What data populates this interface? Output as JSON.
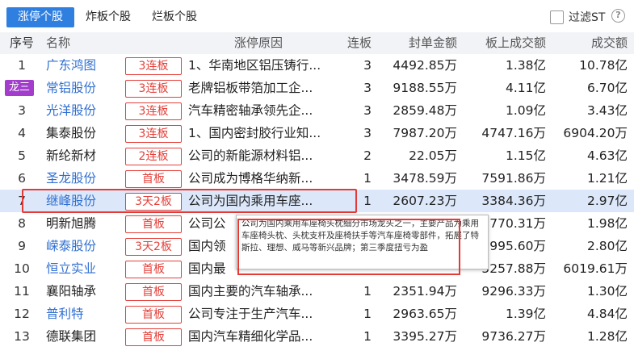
{
  "tabs": [
    {
      "label": "涨停个股",
      "active": true
    },
    {
      "label": "炸板个股",
      "active": false
    },
    {
      "label": "烂板个股",
      "active": false
    }
  ],
  "filter": {
    "label": "过滤ST",
    "checked": false
  },
  "help": {
    "symbol": "?"
  },
  "columns": {
    "idx": "序号",
    "name": "名称",
    "reason": "涨停原因",
    "lianban": "连板",
    "amount": "封单金额",
    "volume": "板上成交额",
    "turnover": "成交额"
  },
  "rows": [
    {
      "idx": "1",
      "name": "广东鸿图",
      "blue": true,
      "badge": "3连板",
      "reason": "1、华南地区铝压铸行...",
      "lb": "3",
      "amt": "4492.85万",
      "vol": "1.38亿",
      "turn": "10.78亿"
    },
    {
      "idx": "2",
      "name": "常铝股份",
      "blue": true,
      "tag": "龙三",
      "badge": "3连板",
      "reason": "老牌铝板带箔加工企...",
      "lb": "3",
      "amt": "9188.55万",
      "vol": "4.11亿",
      "turn": "6.70亿"
    },
    {
      "idx": "3",
      "name": "光洋股份",
      "blue": true,
      "badge": "3连板",
      "reason": "汽车精密轴承领先企...",
      "lb": "3",
      "amt": "2859.48万",
      "vol": "1.09亿",
      "turn": "3.43亿"
    },
    {
      "idx": "4",
      "name": "集泰股份",
      "blue": false,
      "badge": "3连板",
      "reason": "1、国内密封胶行业知...",
      "lb": "3",
      "amt": "7987.20万",
      "vol": "4747.16万",
      "turn": "6904.20万"
    },
    {
      "idx": "5",
      "name": "新纶新材",
      "blue": false,
      "badge": "2连板",
      "reason": "公司的新能源材料铝...",
      "lb": "2",
      "amt": "22.05万",
      "vol": "1.15亿",
      "turn": "4.63亿"
    },
    {
      "idx": "6",
      "name": "圣龙股份",
      "blue": true,
      "badge": "首板",
      "reason": "公司成为博格华纳新...",
      "lb": "1",
      "amt": "3478.59万",
      "vol": "7591.86万",
      "turn": "1.21亿"
    },
    {
      "idx": "7",
      "name": "继峰股份",
      "blue": true,
      "selected": true,
      "badge": "3天2板",
      "reason": "公司为国内乘用车座...",
      "lb": "1",
      "amt": "2607.23万",
      "vol": "3384.36万",
      "turn": "2.97亿"
    },
    {
      "idx": "8",
      "name": "明新旭腾",
      "blue": false,
      "badge": "首板",
      "reason": "公司公",
      "lb": "",
      "amt": "",
      "vol": "770.31万",
      "turn": "1.98亿"
    },
    {
      "idx": "9",
      "name": "嵘泰股份",
      "blue": true,
      "badge": "3天2板",
      "reason": "国内领",
      "lb": "",
      "amt": "",
      "vol": "995.60万",
      "turn": "2.80亿"
    },
    {
      "idx": "10",
      "name": "恒立实业",
      "blue": true,
      "badge": "首板",
      "reason": "国内最",
      "lb": "",
      "amt": "",
      "vol": "5257.88万",
      "turn": "6019.61万"
    },
    {
      "idx": "11",
      "name": "襄阳轴承",
      "blue": false,
      "badge": "首板",
      "reason": "国内主要的汽车轴承...",
      "lb": "1",
      "amt": "2351.94万",
      "vol": "9296.33万",
      "turn": "1.30亿"
    },
    {
      "idx": "12",
      "name": "普利特",
      "blue": true,
      "badge": "首板",
      "reason": "公司专注于生产汽车...",
      "lb": "1",
      "amt": "2963.65万",
      "vol": "1.39亿",
      "turn": "4.84亿"
    },
    {
      "idx": "13",
      "name": "德联集团",
      "blue": false,
      "badge": "首板",
      "reason": "国内汽车精细化学品...",
      "lb": "1",
      "amt": "3395.27万",
      "vol": "9736.27万",
      "turn": "1.28亿"
    }
  ],
  "tooltip": {
    "text": "公司为国内乘用车座椅头枕细分市场龙头之一，主要产品为乘用车座椅头枕、头枕支杆及座椅扶手等汽车座椅零部件，拓展了特斯拉、理想、威马等新兴品牌；第三季度扭亏为盈"
  },
  "colors": {
    "accent": "#2f7fe0",
    "badge_red": "#e5403a",
    "highlight_red": "#e53935",
    "name_blue": "#2f6fd1",
    "tag_purple": "#a23dcc",
    "selected_row": "#dce8fa"
  }
}
